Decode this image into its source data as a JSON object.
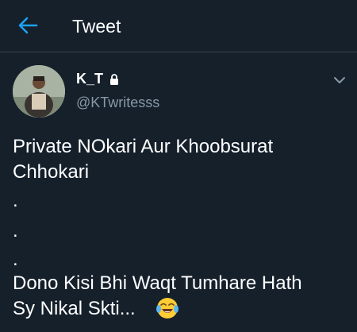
{
  "header": {
    "title": "Tweet",
    "back_icon": "arrow-left-icon"
  },
  "author": {
    "name": "K_T",
    "handle": "@KTwritesss",
    "protected_icon": "lock-icon",
    "more_icon": "chevron-down-icon"
  },
  "tweet": {
    "lines": [
      "Private NOkari Aur Khoobsurat",
      "Chhokari",
      ".",
      ".",
      ".",
      "Dono Kisi Bhi Waqt Tumhare Hath",
      "Sy Nikal Skti..."
    ],
    "emoji": "face-with-tears-of-joy-icon"
  },
  "colors": {
    "background": "#15202b",
    "accent": "#1da1f2",
    "secondary_text": "#8899a6",
    "divider": "#38444d"
  }
}
